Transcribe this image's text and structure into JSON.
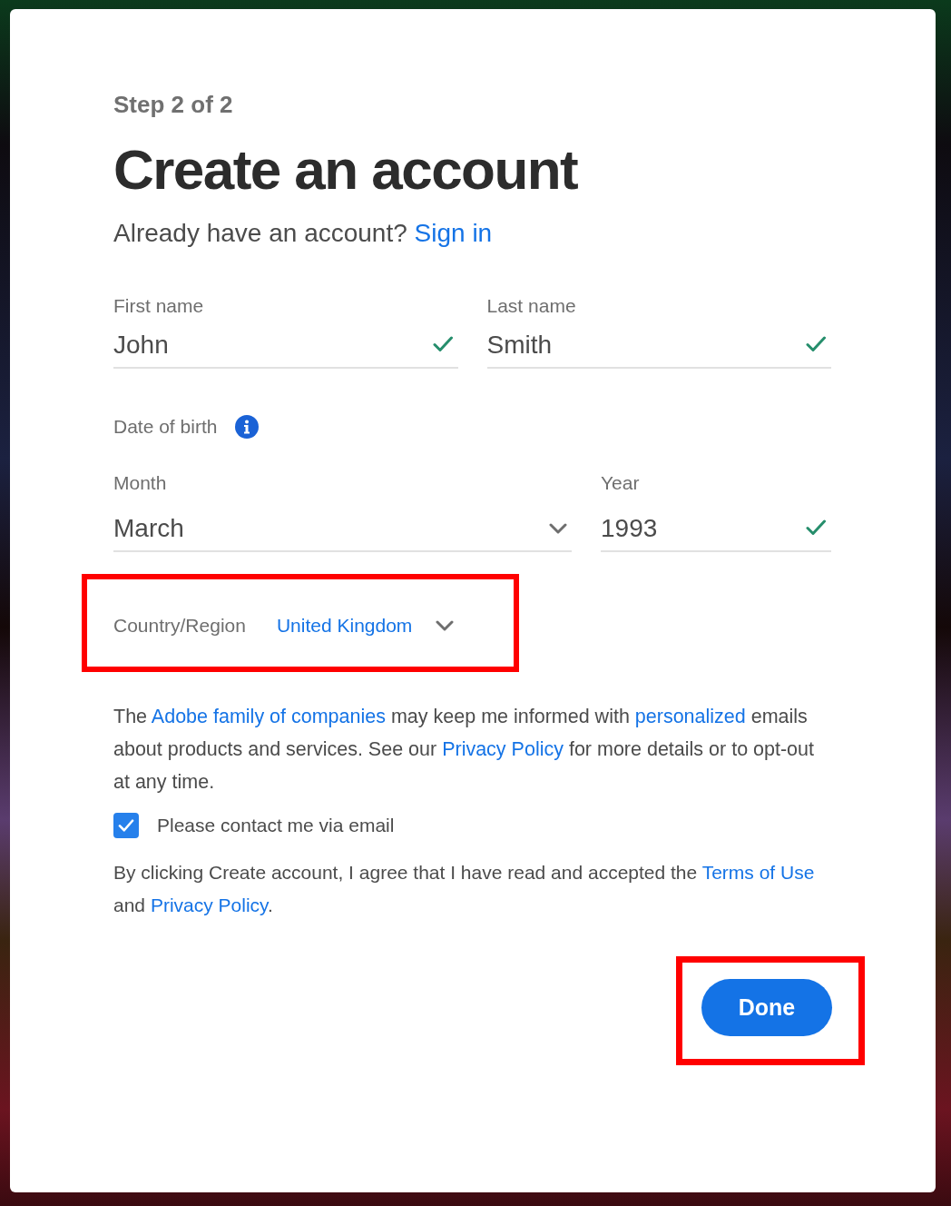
{
  "step": "Step 2 of 2",
  "title": "Create an account",
  "sign_in": {
    "prompt": "Already have an account?",
    "link": "Sign in"
  },
  "name_fields": [
    {
      "label": "First name",
      "value": "John",
      "kind": "text",
      "valid": true
    },
    {
      "label": "Last name",
      "value": "Smith",
      "kind": "text",
      "valid": true
    }
  ],
  "date_of_birth": {
    "label": "Date of birth",
    "fields": [
      {
        "label": "Month",
        "value": "March",
        "kind": "select",
        "valid": false
      },
      {
        "label": "Year",
        "value": "1993",
        "kind": "text",
        "valid": true
      }
    ]
  },
  "country_region": {
    "label": "Country/Region",
    "value": "United Kingdom",
    "highlighted": true
  },
  "marketing_notice": [
    {
      "text": "The "
    },
    {
      "text": "Adobe family of companies",
      "link": true
    },
    {
      "text": " may keep me informed with "
    },
    {
      "text": "personalized",
      "link": true
    },
    {
      "text": " emails about products and services. See our "
    },
    {
      "text": "Privacy Policy",
      "link": true
    },
    {
      "text": " for more details or to opt-out at any time."
    }
  ],
  "contact_checkbox": {
    "label": "Please contact me via email",
    "checked": true
  },
  "terms_notice": [
    {
      "text": "By clicking Create account, I agree that I have read and accepted the "
    },
    {
      "text": "Terms of Use",
      "link": true
    },
    {
      "text": " and "
    },
    {
      "text": "Privacy Policy",
      "link": true
    },
    {
      "text": "."
    }
  ],
  "done_button": {
    "label": "Done",
    "highlighted": true
  }
}
